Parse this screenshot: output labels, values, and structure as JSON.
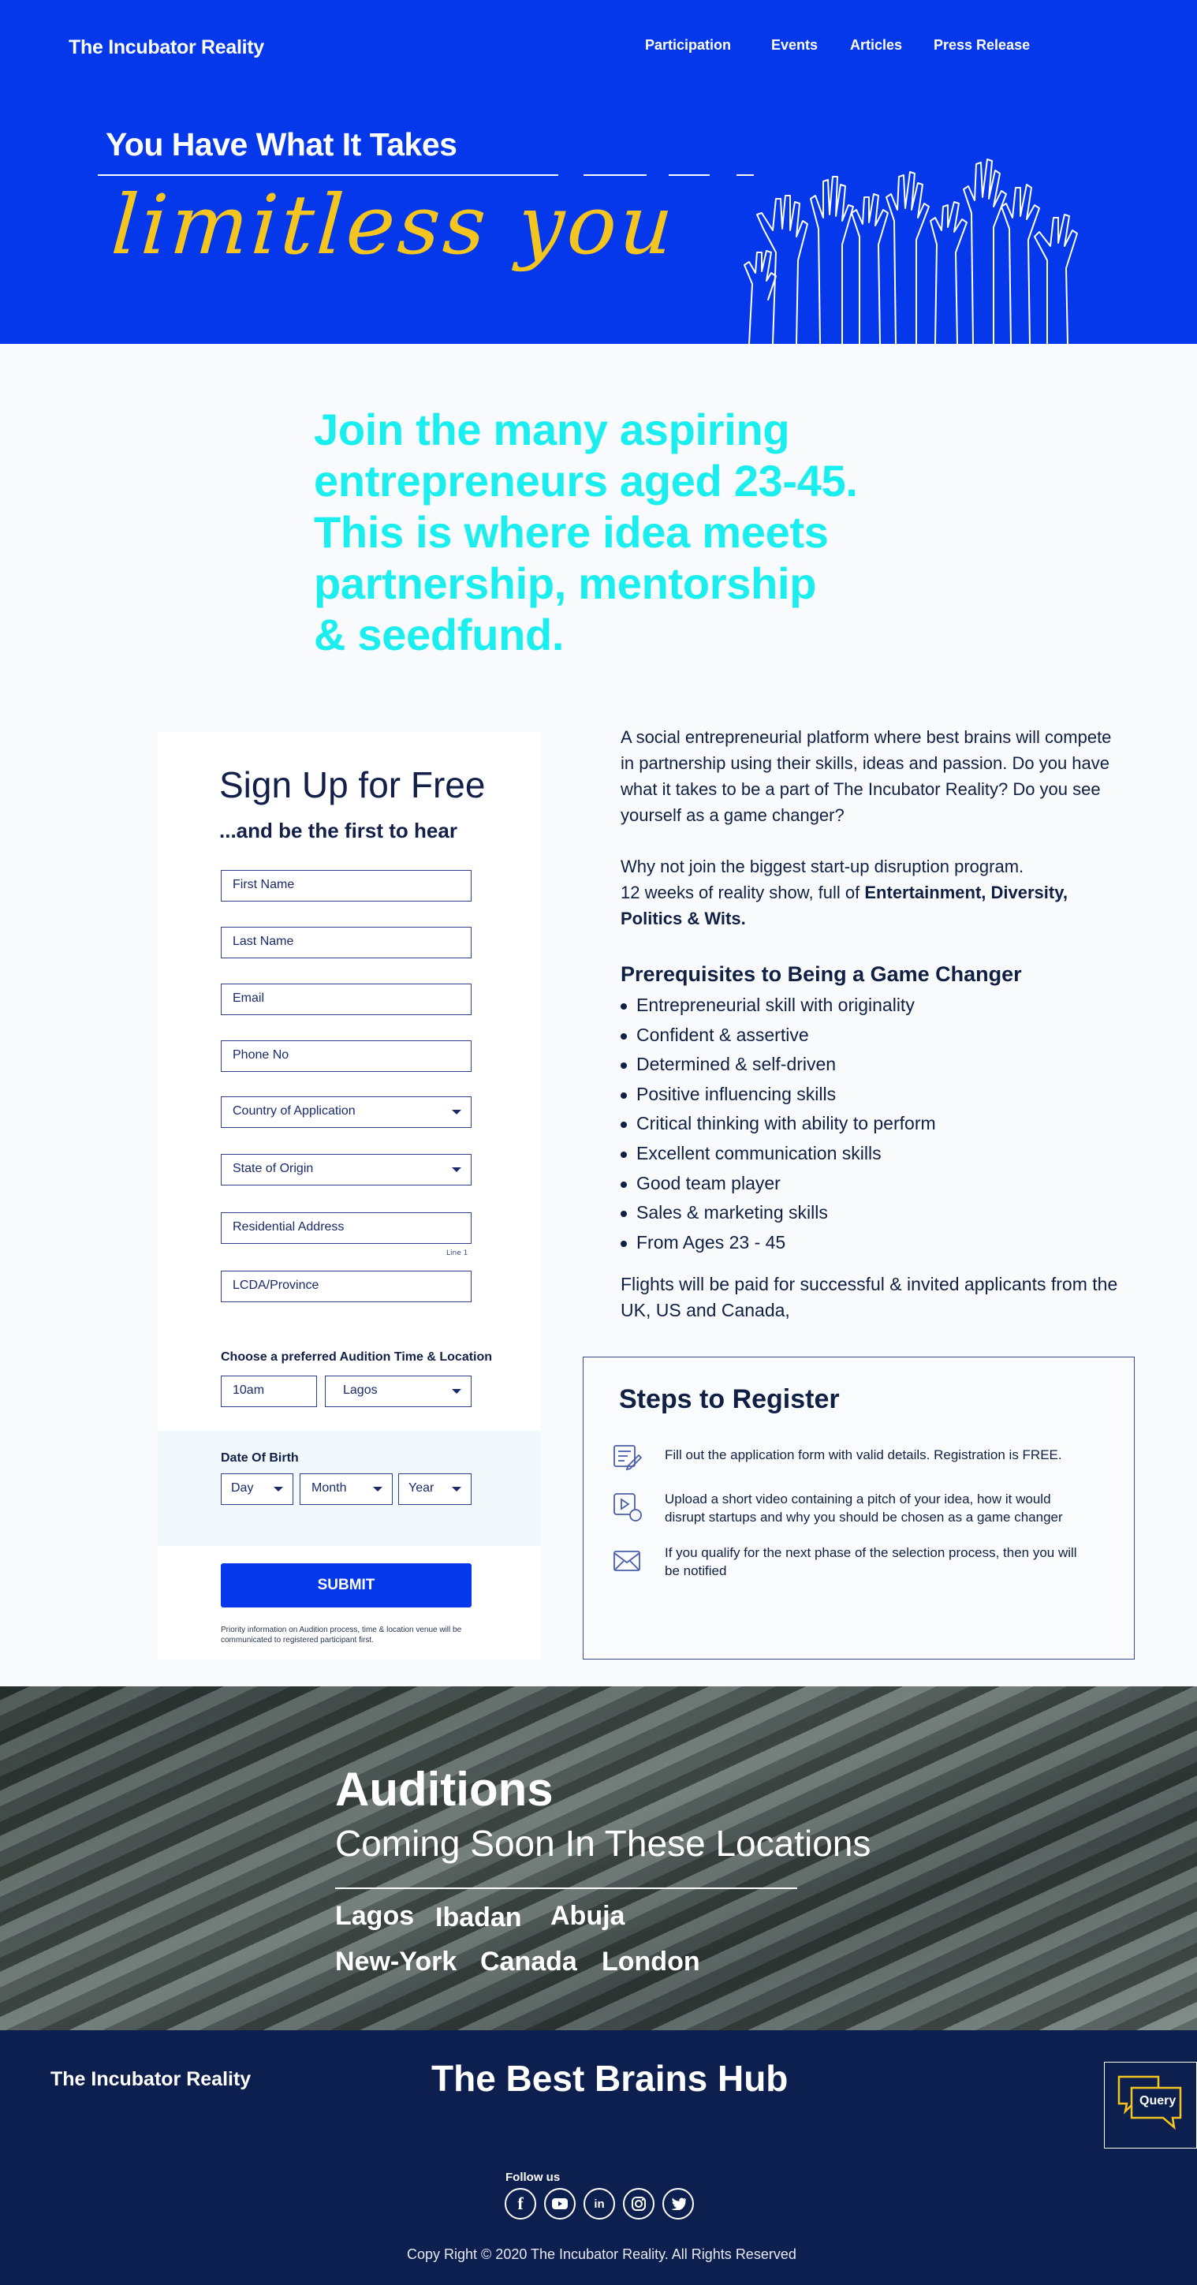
{
  "header": {
    "brand": "The Incubator Reality",
    "nav": [
      "Participation",
      "Events",
      "Articles",
      "Press Release"
    ]
  },
  "hero": {
    "tagline": "You Have What It Takes",
    "script": "limitless you",
    "accent_color": "#f4c51e",
    "bg_color": "#0538ea"
  },
  "intro": {
    "lines": [
      "Join the many aspiring",
      "entrepreneurs aged 23-45.",
      "This is where idea meets",
      "partnership, mentorship",
      "& seedfund."
    ],
    "color": "#1beeee"
  },
  "form": {
    "title": "Sign Up for Free",
    "subtitle": "...and be the first to hear",
    "fields": {
      "first_name": "First Name",
      "last_name": "Last Name",
      "email": "Email",
      "phone": "Phone No",
      "country": "Country of Application",
      "state": "State of Origin",
      "address": "Residential Address",
      "address_hint": "Line 1",
      "lcda": "LCDA/Province"
    },
    "audition_label": "Choose a preferred Audition Time & Location",
    "audition_time": "10am",
    "audition_location": "Lagos",
    "dob_label": "Date Of Birth",
    "dob_day": "Day",
    "dob_month": "Month",
    "dob_year": "Year",
    "submit": "SUBMIT",
    "priority_note": "Priority information on Audition process, time & location venue will be communicated to registered participant first."
  },
  "about": {
    "p1": "A social entrepreneurial platform where best brains will compete in partnership using their skills, ideas and passion. Do you have what it takes to be a part of  The Incubator Reality? Do you see yourself as a game changer?",
    "p2_line1": "Why not join the biggest start-up disruption program.",
    "p2_line2_pre": "12 weeks of reality show, full of ",
    "p2_line2_bold": "Entertainment, Diversity, Politics & Wits.",
    "prereq_title": "Prerequisites to Being a Game Changer",
    "prereqs": [
      "Entrepreneurial skill with originality",
      "Confident & assertive",
      "Determined & self-driven",
      "Positive influencing skills",
      "Critical thinking with ability to perform",
      "Excellent communication skills",
      "Good team player",
      "Sales & marketing skills",
      "From Ages 23 - 45"
    ],
    "flights": "Flights will be paid for successful & invited applicants from the UK, US and Canada,"
  },
  "steps": {
    "title": "Steps to Register",
    "items": [
      {
        "icon": "edit-form-icon",
        "text": "Fill out the application form with valid details. Registration is FREE."
      },
      {
        "icon": "video-upload-icon",
        "text": "Upload a short video containing a pitch of your idea, how it would disrupt startups and why you should be chosen as a game changer"
      },
      {
        "icon": "envelope-icon",
        "text": "If you qualify for the next phase of the selection process, then you will be notified"
      }
    ]
  },
  "auditions": {
    "title": "Auditions",
    "subtitle": "Coming Soon In These Locations",
    "cities_row1": [
      "Lagos",
      "Ibadan",
      "Abuja"
    ],
    "cities_row2": [
      "New-York",
      "Canada",
      "London"
    ]
  },
  "footer": {
    "brand": "The Incubator Reality",
    "hub": "The Best Brains Hub",
    "query": "Query",
    "follow": "Follow us",
    "socials": [
      "facebook-icon",
      "youtube-icon",
      "linkedin-icon",
      "instagram-icon",
      "twitter-icon"
    ],
    "copyright": "Copy Right  © 2020 The Incubator Reality. All Rights Reserved",
    "bg_color": "#0d1f4e"
  }
}
